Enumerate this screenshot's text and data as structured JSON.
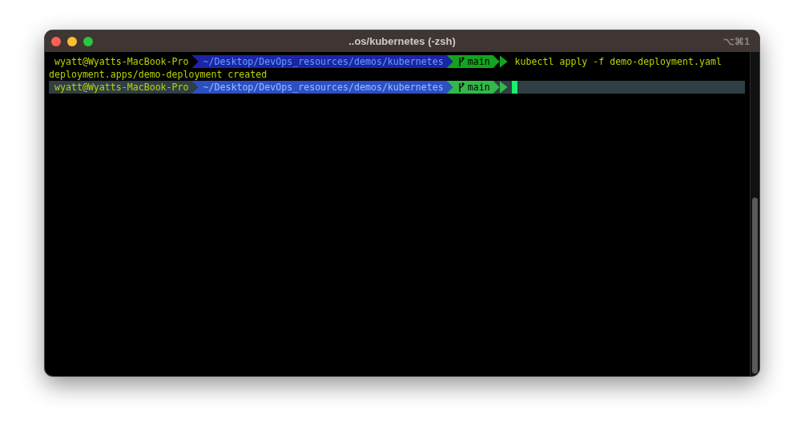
{
  "window": {
    "title": "..os/kubernetes (-zsh)",
    "shortcut": "⌥⌘1"
  },
  "lines": [
    {
      "kind": "prompt",
      "current": false,
      "user": "wyatt@Wyatts-MacBook-Pro",
      "path": "~/Desktop/DevOps_resources/demos/kubernetes",
      "branch": "main",
      "command": "kubectl apply -f demo-deployment.yaml"
    },
    {
      "kind": "output",
      "text": "deployment.apps/demo-deployment created"
    },
    {
      "kind": "prompt",
      "current": true,
      "user": "wyatt@Wyatts-MacBook-Pro",
      "path": "~/Desktop/DevOps_resources/demos/kubernetes",
      "branch": "main"
    }
  ]
}
